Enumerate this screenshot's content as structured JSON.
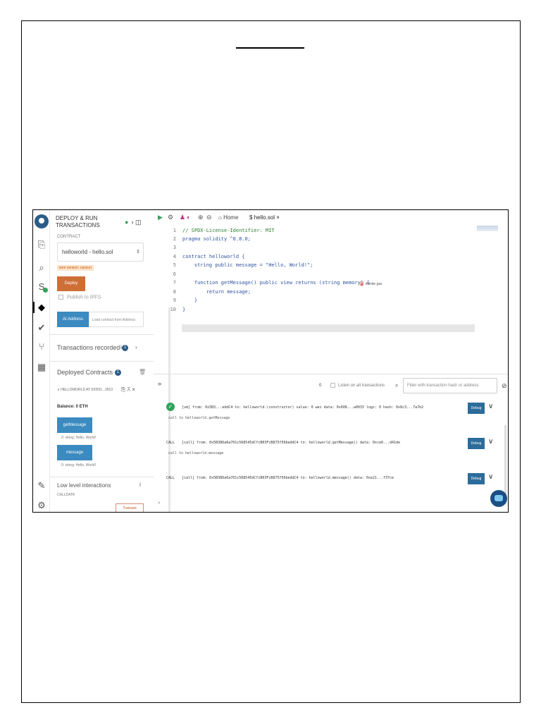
{
  "rail": {
    "icons": [
      "remix-logo-icon",
      "file-explorer-icon",
      "search-icon",
      "solidity-compiler-icon",
      "deploy-run-icon",
      "test-icon",
      "git-icon",
      "learneth-icon",
      "plugin-manager-icon",
      "settings-icon"
    ]
  },
  "panel": {
    "title": "DEPLOY & RUN TRANSACTIONS",
    "contract_label": "CONTRACT",
    "contract_value": "helloworld - hello.sol",
    "evm_badge": "evm version: cancun",
    "deploy_label": "Deploy",
    "ipfs_label": "Publish to IPFS",
    "at_address_label": "At Address",
    "at_address_placeholder": "Load contract from Address",
    "transactions_recorded": "Transactions recorded",
    "transactions_count": "1",
    "deployed_contracts": "Deployed Contracts",
    "deployed_count": "1",
    "instance_label": "HELLOWORLD AT 0XD91...3913",
    "balance": "Balance: 0 ETH",
    "functions": [
      {
        "name": "getMessage",
        "output": "0: string: Hello, World!"
      },
      {
        "name": "message",
        "output": "0: string: Hello, World!"
      }
    ],
    "low_level": "Low level interactions",
    "calldata_label": "CALLDATA",
    "transact_label": "Transact"
  },
  "editor": {
    "home_tab": "Home",
    "file_tab": "hello.sol",
    "gas_hint": "infinite gas",
    "lines": [
      {
        "n": "1",
        "code": "// SPDX-License-Identifier: MIT"
      },
      {
        "n": "2",
        "code": "pragma solidity ^0.8.0;"
      },
      {
        "n": "3",
        "code": ""
      },
      {
        "n": "4",
        "code": "contract helloworld {"
      },
      {
        "n": "5",
        "code": "    string public message = \"Hello, World!\";"
      },
      {
        "n": "6",
        "code": ""
      },
      {
        "n": "7",
        "code": "    function getMessage() public view returns (string memory) {"
      },
      {
        "n": "8",
        "code": "        return message;"
      },
      {
        "n": "9",
        "code": "    }"
      },
      {
        "n": "10",
        "code": "}"
      }
    ]
  },
  "terminal": {
    "pending_count": "0",
    "listen_label": "Listen on all transactions",
    "filter_placeholder": "Filter with transaction hash or address",
    "prompt": ">",
    "transactions": [
      {
        "tag": "",
        "text": "[vm] from: 0x5B3...eddC4 to: helloworld.(constructor) value: 0 wei data: 0x608...a0033 logs: 0 hash: 0x8c3...7a7b2",
        "sub": "call to helloworld.getMessage",
        "debug": "Debug"
      },
      {
        "tag": "CALL",
        "text": "[call] from: 0x5B38Da6a701c568545dCfcB03FcB875f56beddC4 to: helloworld.getMessage() data: 0xce6...d41de",
        "sub": "call to helloworld.message",
        "debug": "Debug"
      },
      {
        "tag": "CALL",
        "text": "[call] from: 0x5B38Da6a701c568545dCfcB03FcB875f56beddC4 to: helloworld.message() data: 0xe21...f37ce",
        "sub": "",
        "debug": "Debug"
      }
    ]
  }
}
